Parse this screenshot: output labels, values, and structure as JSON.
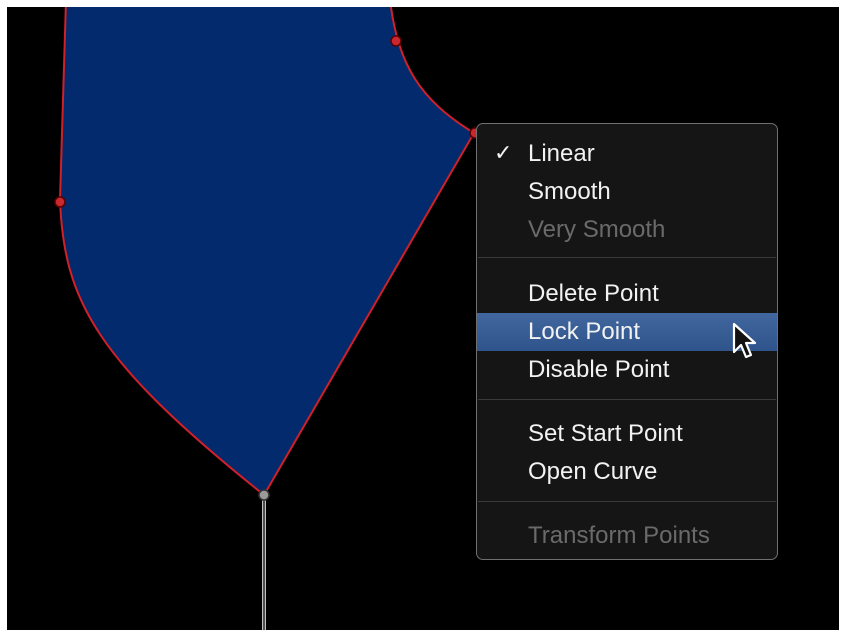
{
  "menu": {
    "items": [
      {
        "label": "Linear",
        "checked": true,
        "enabled": true
      },
      {
        "label": "Smooth",
        "checked": false,
        "enabled": true
      },
      {
        "label": "Very Smooth",
        "checked": false,
        "enabled": false
      },
      {
        "label": "Delete Point",
        "checked": false,
        "enabled": true
      },
      {
        "label": "Lock Point",
        "checked": false,
        "enabled": true,
        "highlighted": true
      },
      {
        "label": "Disable Point",
        "checked": false,
        "enabled": true
      },
      {
        "label": "Set Start Point",
        "checked": false,
        "enabled": true
      },
      {
        "label": "Open Curve",
        "checked": false,
        "enabled": true
      },
      {
        "label": "Transform Points",
        "checked": false,
        "enabled": false
      }
    ],
    "check_glyph": "✓"
  },
  "colors": {
    "shape_fill": "#032a6c",
    "shape_stroke": "#d0202a",
    "control_point": "#c8282e",
    "highlight": "#3a5f97"
  }
}
